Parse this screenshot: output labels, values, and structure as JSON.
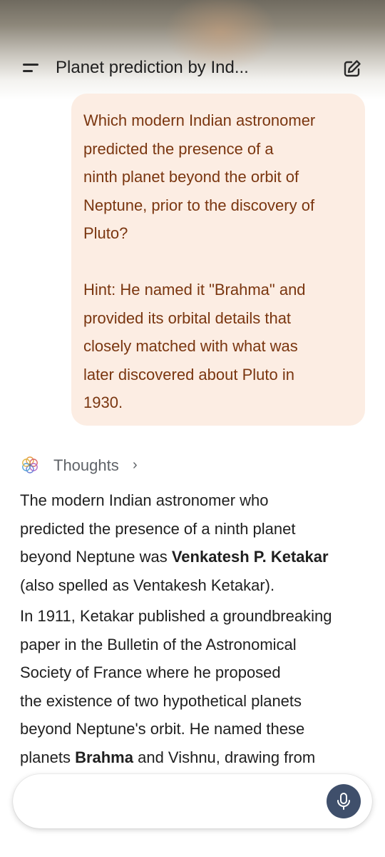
{
  "header": {
    "title": "Planet prediction by Ind..."
  },
  "user_message": {
    "paragraph1_lines": [
      "Which modern Indian astronomer",
      "predicted the presence of a",
      "ninth planet beyond the orbit of",
      "Neptune, prior to the discovery of",
      "Pluto?"
    ],
    "paragraph2_lines": [
      "Hint: He named it \"Brahma\" and",
      "provided its orbital details that",
      "closely matched with what was",
      "later discovered about Pluto in",
      "1930."
    ]
  },
  "thoughts": {
    "label": "Thoughts",
    "chevron": "›"
  },
  "response": {
    "p1": {
      "l1": "The modern Indian astronomer who",
      "l2": "predicted the presence of a ninth planet",
      "l3_pre": "beyond Neptune was ",
      "l3_bold": "Venkatesh P. Ketakar",
      "l4": "(also spelled as Ventakesh Ketakar)."
    },
    "p2": {
      "l1": "In 1911, Ketakar published a groundbreaking",
      "l2": "paper in the Bulletin of the Astronomical",
      "l3": "Society of France where he proposed",
      "l4": "the existence of two hypothetical planets",
      "l5": "beyond Neptune's orbit. He named these",
      "l6_pre": "planets ",
      "l6_bold": "Brahma",
      "l6_post": " and Vishnu, drawing from"
    }
  },
  "input": {
    "placeholder": ""
  },
  "icons": {
    "menu": "menu-icon",
    "edit": "edit-icon",
    "thoughts": "sparkle-icon",
    "mic": "mic-icon"
  },
  "colors": {
    "user_bubble_bg": "#fcede3",
    "user_text": "#7a3610",
    "mic_button": "#3f4f6b"
  }
}
